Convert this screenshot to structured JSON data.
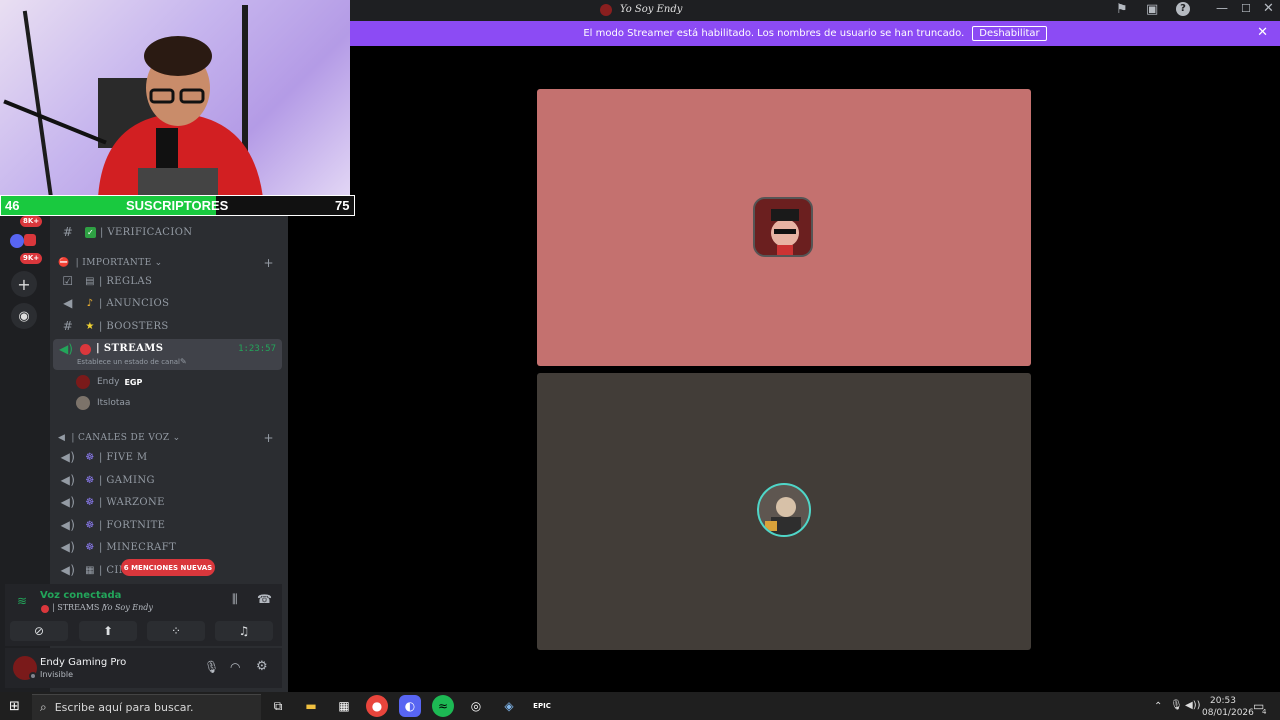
{
  "webcam": {
    "sub_left": "46",
    "sub_label": "SUSCRIPTORES",
    "sub_right": "75",
    "sub_progress": 0.61
  },
  "window": {
    "title": "Yo Soy Endy"
  },
  "banner": {
    "text": "El modo Streamer está habilitado. Los nombres de usuario se han truncado.",
    "button": "Deshabilitar"
  },
  "rail": {
    "badges": [
      "8K+",
      "9K+"
    ]
  },
  "channels": {
    "verificacion": "| VERIFICACION",
    "category_importante": "| IMPORTANTE",
    "reglas": "| REGLAS",
    "anuncios": "| ANUNCIOS",
    "boosters": "| BOOSTERS",
    "streams": "| STREAMS",
    "streams_time": "1:23:57",
    "streams_status": "Establece un estado de canal",
    "member1_name": "Endy",
    "member1_tag": "EGP",
    "member2_name": "Itslotaa",
    "category_voz": "| CANALES DE VOZ",
    "fivem": "| FIVE M",
    "gaming": "| GAMING",
    "warzone": "| WARZONE",
    "fortnite": "| FORTNITE",
    "minecraft": "| MINECRAFT",
    "cine": "| CINE",
    "mentions": "6 MENCIONES NUEVAS"
  },
  "voice": {
    "status": "Voz conectada",
    "channel": "| STREAMS /",
    "server": "Yo Soy Endy"
  },
  "user": {
    "name": "Endy Gaming Pro",
    "status": "Invisible"
  },
  "taskbar": {
    "search_placeholder": "Escribe aquí para buscar.",
    "time": "20:53",
    "date": "08/01/2026",
    "notif_count": "4"
  },
  "colors": {
    "banner": "#8c4bf4",
    "tile1": "#c4716f",
    "tile2": "#423d38",
    "sub_fill": "#19c93f"
  }
}
